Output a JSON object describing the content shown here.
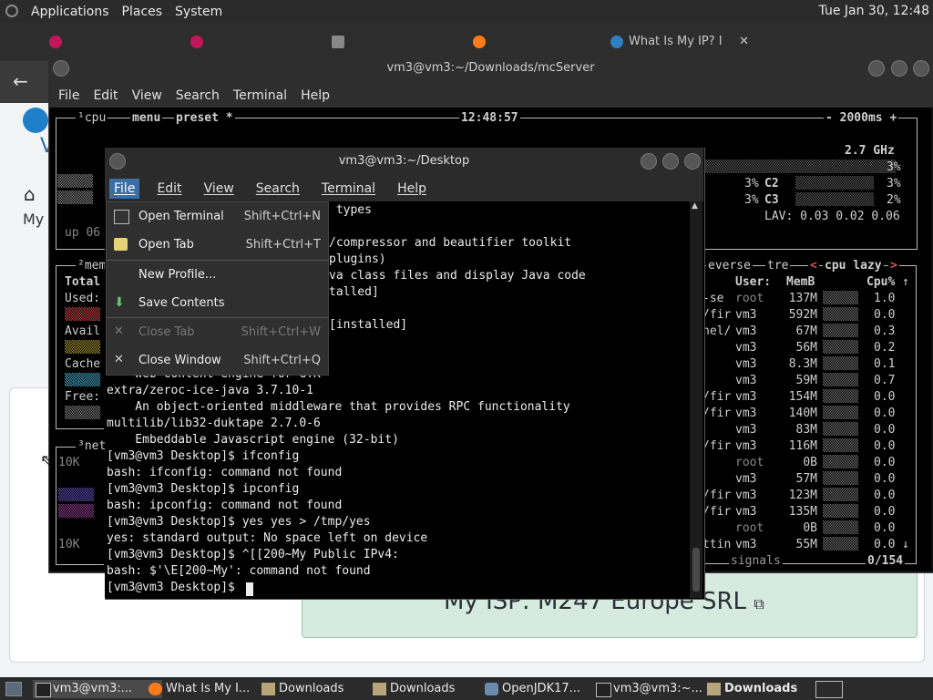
{
  "top_panel": {
    "menus": [
      "Applications",
      "Places",
      "System"
    ],
    "clock": "Tue Jan 30, 12:48"
  },
  "browser": {
    "tabs": [
      {
        "label": "",
        "icon": "app-icon"
      },
      {
        "label": "",
        "icon": "app-icon"
      },
      {
        "label": "",
        "icon": "speaker-icon"
      },
      {
        "label": "",
        "icon": "firefox-icon"
      },
      {
        "label": "What Is My IP? I",
        "icon": "globe-icon"
      }
    ],
    "page_partial_v": "V",
    "page_partial_my": "My",
    "isp_label": "My ISP:",
    "isp_value": "M247 Europe SRL"
  },
  "back_terminal": {
    "title": "vm3@vm3:~/Downloads/mcServer",
    "menu": [
      "File",
      "Edit",
      "View",
      "Search",
      "Terminal",
      "Help"
    ],
    "btop": {
      "cpu_header": "¹cpu",
      "menu_tab": "menu",
      "preset_tab": "preset *",
      "time": "12:48:57",
      "interval": "- 2000ms +",
      "ghz": "2.7 GHz",
      "cpu_pct_1": "3%",
      "c2_label": "C2",
      "c2_pct": "3%",
      "c3_label": "C3",
      "c3_pct": "2%",
      "left_pct_1": "3%",
      "left_pct_2": "3%",
      "lav": "LAV: 0.03 0.02 0.06",
      "uptime": "up 06",
      "mem_header": "²mem",
      "mem_total": "Total",
      "mem_used": "Used:",
      "mem_avail": "Avail",
      "mem_cached": "Cache",
      "mem_free": "Free:",
      "net_header": "³net",
      "net_top": "10K",
      "net_bottom": "10K",
      "proc_tabs": {
        "reverse": "everse",
        "tree": "tre",
        "sort": "cpu lazy"
      },
      "proc_header": {
        "user": "User:",
        "mem": "MemB",
        "cpu": "Cpu%"
      },
      "proc_rows": [
        {
          "cmd": "-se",
          "user": "root",
          "mem": "137M",
          "cpu": "1.0"
        },
        {
          "cmd": "/fir",
          "user": "vm3",
          "mem": "592M",
          "cpu": "0.0"
        },
        {
          "cmd": "nel/",
          "user": "vm3",
          "mem": "67M",
          "cpu": "0.3"
        },
        {
          "cmd": "",
          "user": "vm3",
          "mem": "56M",
          "cpu": "0.2"
        },
        {
          "cmd": "",
          "user": "vm3",
          "mem": "8.3M",
          "cpu": "0.1"
        },
        {
          "cmd": "",
          "user": "vm3",
          "mem": "59M",
          "cpu": "0.7"
        },
        {
          "cmd": "/fir",
          "user": "vm3",
          "mem": "154M",
          "cpu": "0.0"
        },
        {
          "cmd": "/fir",
          "user": "vm3",
          "mem": "140M",
          "cpu": "0.0"
        },
        {
          "cmd": "",
          "user": "vm3",
          "mem": "83M",
          "cpu": "0.0"
        },
        {
          "cmd": "/fir",
          "user": "vm3",
          "mem": "116M",
          "cpu": "0.0"
        },
        {
          "cmd": "",
          "user": "root",
          "mem": "0B",
          "cpu": "0.0"
        },
        {
          "cmd": "",
          "user": "vm3",
          "mem": "57M",
          "cpu": "0.0"
        },
        {
          "cmd": "/fir",
          "user": "vm3",
          "mem": "123M",
          "cpu": "0.0"
        },
        {
          "cmd": "/fir",
          "user": "vm3",
          "mem": "135M",
          "cpu": "0.0"
        },
        {
          "cmd": "",
          "user": "root",
          "mem": "0B",
          "cpu": "0.0"
        },
        {
          "cmd": "ttin",
          "user": "vm3",
          "mem": "55M",
          "cpu": "0.0"
        }
      ],
      "signals": "signals",
      "count": "0/154"
    }
  },
  "front_terminal": {
    "title": "vm3@vm3:~/Desktop",
    "menu": [
      "File",
      "Edit",
      "View",
      "Search",
      "Terminal",
      "Help"
    ],
    "lines": [
      " types",
      "",
      "/compressor and beautifier toolkit",
      "plugins)",
      "va class files and display Java code",
      "talled]",
      "",
      "[installed]",
      "",
      "",
      "    Web content engine for GTK",
      "extra/zeroc-ice-java 3.7.10-1",
      "    An object-oriented middleware that provides RPC functionality",
      "multilib/lib32-duktape 2.7.0-6",
      "    Embeddable Javascript engine (32-bit)",
      "[vm3@vm3 Desktop]$ ifconfig",
      "bash: ifconfig: command not found",
      "[vm3@vm3 Desktop]$ ipconfig",
      "bash: ipconfig: command not found",
      "[vm3@vm3 Desktop]$ yes yes > /tmp/yes",
      "yes: standard output: No space left on device",
      "[vm3@vm3 Desktop]$ ^[[200~My Public IPv4:",
      "bash: $'\\E[200~My': command not found",
      "[vm3@vm3 Desktop]$ "
    ],
    "file_menu": [
      {
        "label": "Open Terminal",
        "shortcut": "Shift+Ctrl+N",
        "disabled": false
      },
      {
        "label": "Open Tab",
        "shortcut": "Shift+Ctrl+T",
        "disabled": false
      },
      {
        "label": "New Profile...",
        "shortcut": "",
        "disabled": false
      },
      {
        "label": "Save Contents",
        "shortcut": "",
        "disabled": false
      },
      {
        "label": "Close Tab",
        "shortcut": "Shift+Ctrl+W",
        "disabled": true
      },
      {
        "label": "Close Window",
        "shortcut": "Shift+Ctrl+Q",
        "disabled": false
      }
    ]
  },
  "taskbar": {
    "items": [
      {
        "label": "vm3@vm3:...",
        "active": true
      },
      {
        "label": "What Is My I...",
        "active": false
      },
      {
        "label": "Downloads",
        "active": false
      },
      {
        "label": "Downloads",
        "active": false
      },
      {
        "label": "OpenJDK17...",
        "active": false
      },
      {
        "label": "vm3@vm3:~...",
        "active": false
      },
      {
        "label": "Downloads",
        "active": false
      }
    ]
  },
  "colors": {
    "menu_highlight": "#3a6ea5",
    "isp_box": "#d7eadf",
    "terminal_bg": "#000000"
  }
}
